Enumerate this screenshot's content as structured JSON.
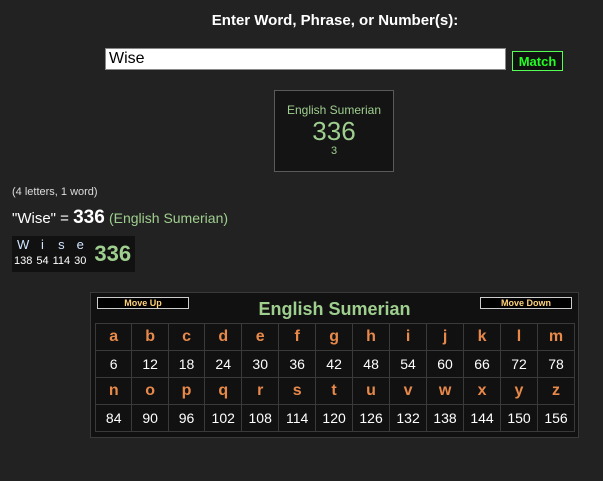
{
  "prompt": "Enter Word, Phrase, or Number(s):",
  "search": {
    "value": "Wise",
    "button": "Match"
  },
  "cipher_box": {
    "name": "English Sumerian",
    "value": "336",
    "count": "3"
  },
  "result": {
    "word_count": "(4 letters, 1 word)",
    "phrase": "\"Wise\"",
    "equals": " = ",
    "total": "336",
    "cipher_name": "(English Sumerian)"
  },
  "breakdown": {
    "letters": [
      {
        "letter": "W",
        "value": "138"
      },
      {
        "letter": "i",
        "value": "54"
      },
      {
        "letter": "s",
        "value": "114"
      },
      {
        "letter": "e",
        "value": "30"
      }
    ],
    "sum": "336"
  },
  "chart": {
    "title": "English Sumerian",
    "move_up": "Move Up",
    "move_down": "Move Down",
    "row1_letters": [
      "a",
      "b",
      "c",
      "d",
      "e",
      "f",
      "g",
      "h",
      "i",
      "j",
      "k",
      "l",
      "m"
    ],
    "row1_values": [
      "6",
      "12",
      "18",
      "24",
      "30",
      "36",
      "42",
      "48",
      "54",
      "60",
      "66",
      "72",
      "78"
    ],
    "row2_letters": [
      "n",
      "o",
      "p",
      "q",
      "r",
      "s",
      "t",
      "u",
      "v",
      "w",
      "x",
      "y",
      "z"
    ],
    "row2_values": [
      "84",
      "90",
      "96",
      "102",
      "108",
      "114",
      "120",
      "126",
      "132",
      "138",
      "144",
      "150",
      "156"
    ]
  }
}
